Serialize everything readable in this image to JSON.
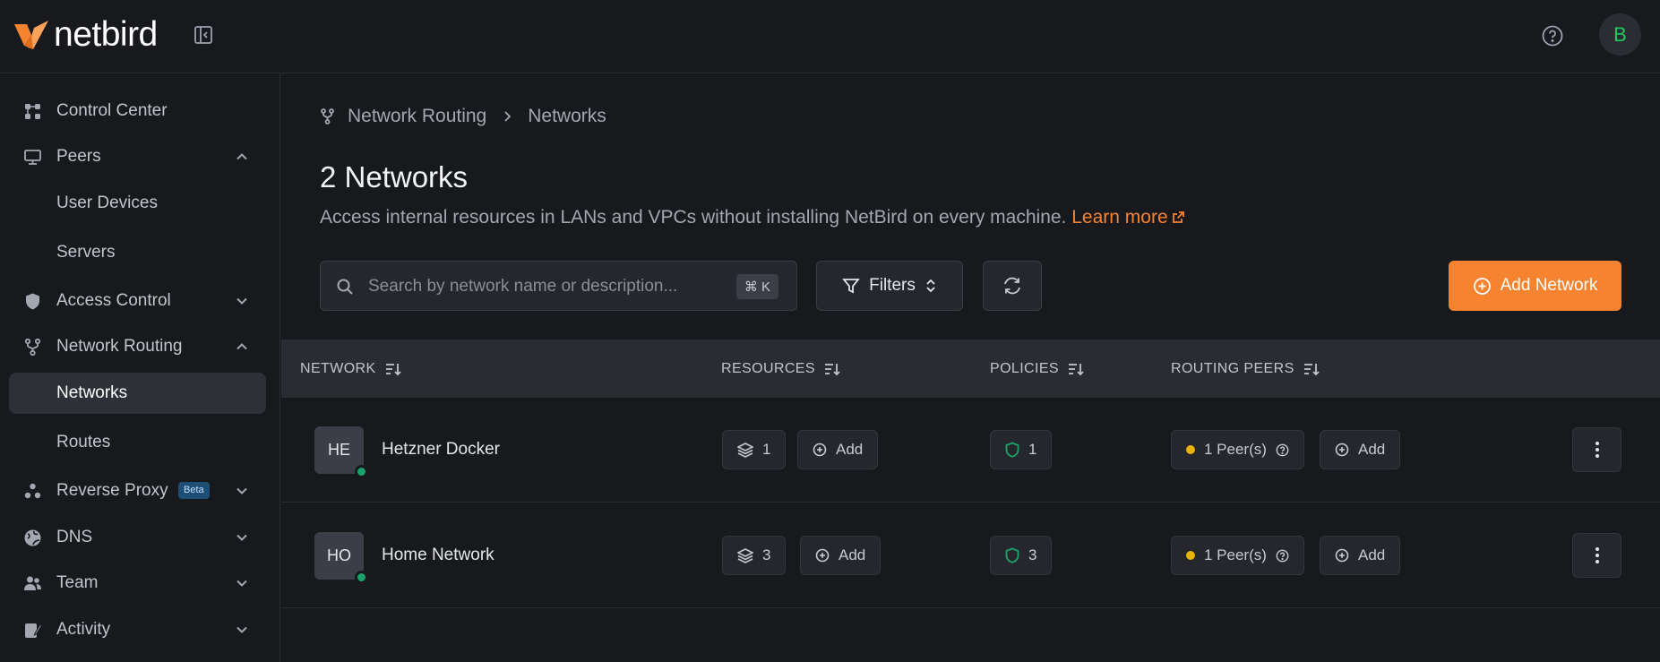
{
  "app": {
    "brand": "netbird",
    "avatar_initial": "B",
    "accent_color": "#f68330"
  },
  "sidebar": {
    "items": [
      {
        "label": "Control Center"
      },
      {
        "label": "Peers"
      },
      {
        "label": "User Devices"
      },
      {
        "label": "Servers"
      },
      {
        "label": "Access Control"
      },
      {
        "label": "Network Routing"
      },
      {
        "label": "Networks"
      },
      {
        "label": "Routes"
      },
      {
        "label": "Reverse Proxy",
        "badge": "Beta"
      },
      {
        "label": "DNS"
      },
      {
        "label": "Team"
      },
      {
        "label": "Activity"
      }
    ]
  },
  "breadcrumb": {
    "parent": "Network Routing",
    "current": "Networks"
  },
  "page": {
    "title": "2 Networks",
    "description": "Access internal resources in LANs and VPCs without installing NetBird on every machine.",
    "learn_more": "Learn more"
  },
  "toolbar": {
    "search_placeholder": "Search by network name or description...",
    "shortcut": "⌘ K",
    "filters_label": "Filters",
    "add_label": "Add Network"
  },
  "table": {
    "columns": [
      "NETWORK",
      "RESOURCES",
      "POLICIES",
      "ROUTING PEERS"
    ],
    "rows": [
      {
        "initials": "HE",
        "name": "Hetzner Docker",
        "resources": "1",
        "resources_add": "Add",
        "policies": "1",
        "peers": "1 Peer(s)",
        "peers_add": "Add"
      },
      {
        "initials": "HO",
        "name": "Home Network",
        "resources": "3",
        "resources_add": "Add",
        "policies": "3",
        "peers": "1 Peer(s)",
        "peers_add": "Add"
      }
    ]
  }
}
